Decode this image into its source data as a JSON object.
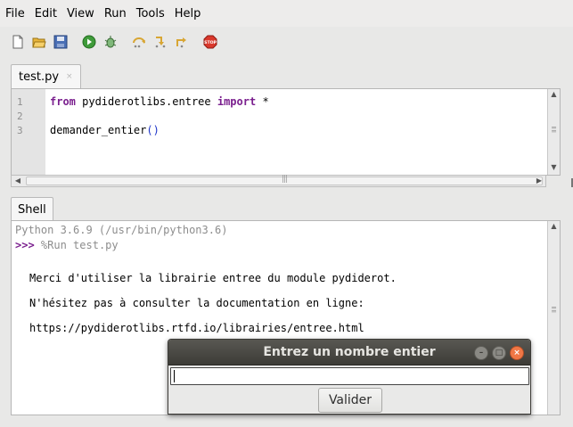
{
  "menu": [
    "File",
    "Edit",
    "View",
    "Run",
    "Tools",
    "Help"
  ],
  "toolbar": {
    "icons": [
      "new-file-icon",
      "open-folder-icon",
      "save-icon",
      "run-icon",
      "debug-icon",
      "step-over-icon",
      "step-into-icon",
      "step-out-icon",
      "stop-icon"
    ],
    "stop_label": "STOP"
  },
  "editor": {
    "tab_label": "test.py",
    "tab_close": "×",
    "line_numbers": [
      "1",
      "2",
      "3"
    ],
    "line1": {
      "kw1": "from",
      "module": " pydiderotlibs.entree ",
      "kw2": "import",
      "rest": " *"
    },
    "line3": {
      "func": "demander_entier",
      "parens": "()"
    }
  },
  "shell": {
    "tab_label": "Shell",
    "lines": [
      "Python 3.6.9 (/usr/bin/python3.6)",
      "%Run test.py",
      "Merci d'utiliser la librairie entree du module pydiderot.",
      "N'hésitez pas à consulter la documentation en ligne:",
      "https://pydiderotlibs.rtfd.io/librairies/entree.html"
    ],
    "prompt": ">>>"
  },
  "dialog": {
    "title": "Entrez un nombre entier",
    "input_value": "",
    "button_label": "Valider",
    "controls": {
      "minimize": "–",
      "maximize": "□",
      "close": "×"
    }
  },
  "colors": {
    "keyword": "#7a1f8e",
    "paren": "#1d34c8",
    "titlebar": "#3d3c37",
    "close_button": "#f07746"
  }
}
